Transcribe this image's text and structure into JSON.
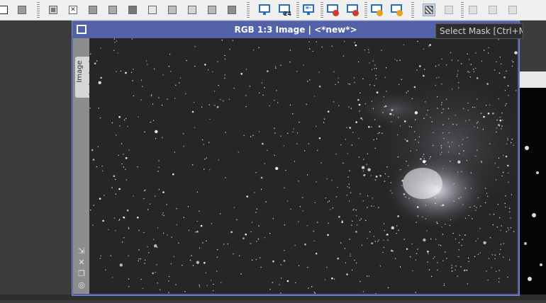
{
  "toolbar": {
    "buttons": [
      {
        "name": "mask-square-1-icon"
      },
      {
        "name": "mask-square-2-icon"
      },
      {
        "name": "mask-square-3-icon"
      },
      {
        "name": "mask-close-icon"
      },
      {
        "name": "mask-square-4-icon"
      },
      {
        "name": "mask-square-5-icon"
      },
      {
        "name": "mask-square-6-icon"
      },
      {
        "name": "mask-square-7-icon"
      },
      {
        "name": "mask-square-8-icon"
      },
      {
        "name": "mask-square-9-icon"
      },
      {
        "name": "mask-square-10-icon"
      },
      {
        "name": "mask-square-11-icon"
      },
      {
        "name": "monitor-icon"
      },
      {
        "name": "monitor-24bit-icon",
        "badge": "24"
      },
      {
        "name": "monitor-arrow-icon"
      },
      {
        "name": "monitor-close-icon"
      },
      {
        "name": "monitor-close-2-icon"
      },
      {
        "name": "monitor-radiation-icon"
      },
      {
        "name": "monitor-radiation-2-icon"
      },
      {
        "name": "select-mask-icon"
      },
      {
        "name": "mask-toggle-icon"
      },
      {
        "name": "mask-view-1-icon"
      },
      {
        "name": "mask-view-2-icon"
      },
      {
        "name": "mask-view-3-icon"
      }
    ]
  },
  "tooltip": {
    "text": "Select Mask [Ctrl+M]"
  },
  "window": {
    "title": "RGB 1:3 Image | <*new*>",
    "tab_label": "Image"
  },
  "colors": {
    "window_frame": "#5261a8",
    "sidebar": "#8d8d8d",
    "canvas": "#262626",
    "accent_blue": "#2a6fb5",
    "badge_red": "#d23a2a",
    "badge_orange": "#e8a21a"
  }
}
